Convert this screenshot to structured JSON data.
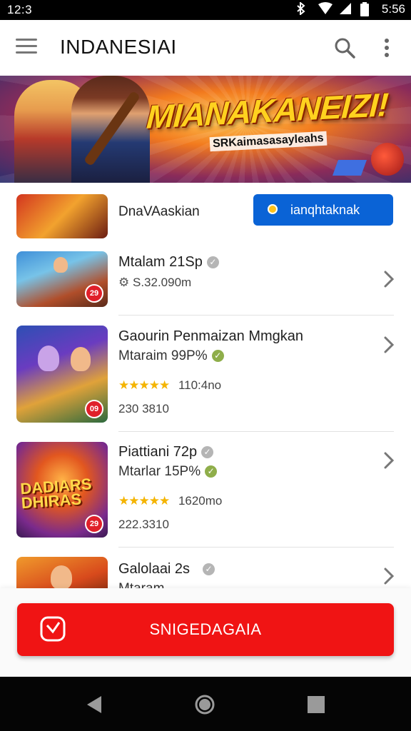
{
  "status": {
    "time": "12:3",
    "clock": "5:56"
  },
  "appbar": {
    "title": "INDANESIAI"
  },
  "banner": {
    "title": "MIANAKANEIZI!",
    "subtitle": "SRKaimasasayleahs"
  },
  "featured": {
    "name": "DnaVAaskian",
    "button_label": "ianqhtaknak"
  },
  "items": [
    {
      "title": "Mtalam 21Sp",
      "meta": "S.32.090m",
      "badge": "29"
    },
    {
      "title": "Gaourin Penmaizan Mmgkan",
      "subtitle": "Mtaraim 99P%",
      "rating": "★★★★★",
      "meta": "110:4no",
      "extra": "230 3810",
      "badge": "09"
    },
    {
      "title": "Piattiani 72p",
      "subtitle": "Mtarlar 15P%",
      "rating": "★★★★★",
      "meta": "1620mo",
      "extra": "222.3310",
      "thumb_text": "DADIARS DHIRAS",
      "badge": "29"
    },
    {
      "title": "Galolaai 2s",
      "subtitle": "Mtaram"
    }
  ],
  "cta": {
    "label": "SNIGEDAGAIA"
  },
  "colors": {
    "accent_blue": "#0a63d6",
    "cta_red": "#f01414",
    "star": "#f4b400"
  },
  "icons": [
    "menu-icon",
    "search-icon",
    "more-vert-icon",
    "chevron-right-icon",
    "back-icon",
    "home-icon",
    "recents-icon"
  ]
}
